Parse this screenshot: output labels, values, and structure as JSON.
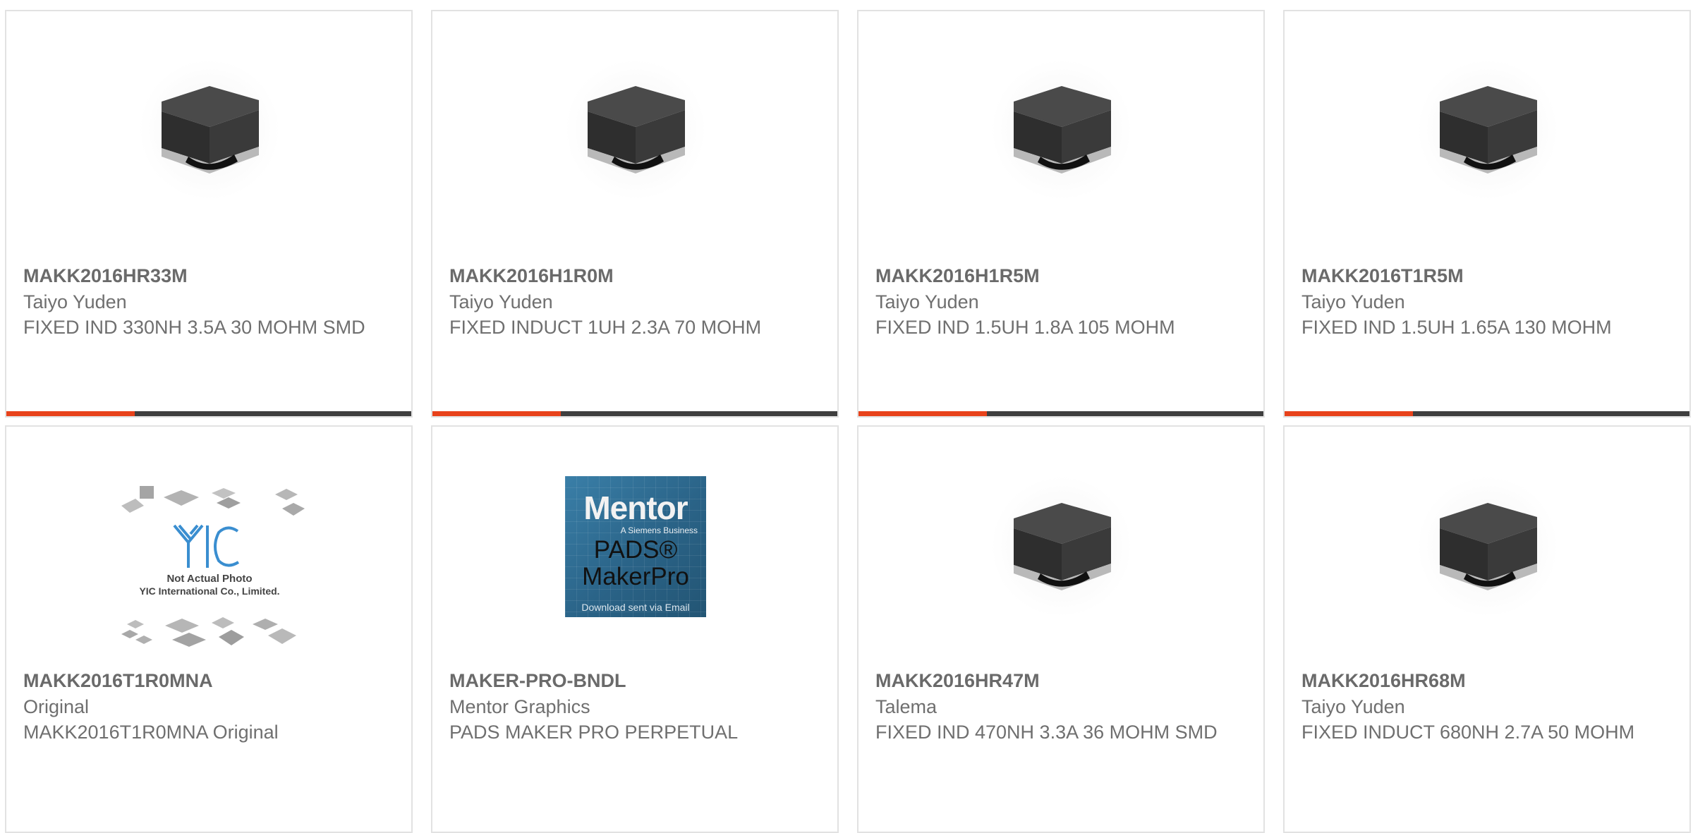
{
  "products": [
    {
      "part_number": "MAKK2016HR33M",
      "manufacturer": "Taiyo Yuden",
      "description": "FIXED IND 330NH 3.5A 30 MOHM SMD",
      "image": "inductor"
    },
    {
      "part_number": "MAKK2016H1R0M",
      "manufacturer": "Taiyo Yuden",
      "description": "FIXED INDUCT 1UH 2.3A 70 MOHM",
      "image": "inductor"
    },
    {
      "part_number": "MAKK2016H1R5M",
      "manufacturer": "Taiyo Yuden",
      "description": "FIXED IND 1.5UH 1.8A 105 MOHM",
      "image": "inductor"
    },
    {
      "part_number": "MAKK2016T1R5M",
      "manufacturer": "Taiyo Yuden",
      "description": "FIXED IND 1.5UH 1.65A 130 MOHM",
      "image": "inductor"
    },
    {
      "part_number": "MAKK2016T1R0MNA",
      "manufacturer": "Original",
      "description": "MAKK2016T1R0MNA Original",
      "image": "yic-placeholder",
      "image_text": {
        "line1": "Not Actual Photo",
        "line2": "YIC International Co., Limited."
      }
    },
    {
      "part_number": "MAKER-PRO-BNDL",
      "manufacturer": "Mentor Graphics",
      "description": "PADS MAKER PRO PERPETUAL",
      "image": "mentor-box",
      "image_text": {
        "brand": "Mentor",
        "tagline": "A Siemens Business",
        "product": "PADS® MakerPro",
        "footer": "Download sent via Email"
      }
    },
    {
      "part_number": "MAKK2016HR47M",
      "manufacturer": "Talema",
      "description": "FIXED IND 470NH 3.3A 36 MOHM SMD",
      "image": "inductor"
    },
    {
      "part_number": "MAKK2016HR68M",
      "manufacturer": "Taiyo Yuden",
      "description": "FIXED INDUCT 680NH 2.7A 50 MOHM",
      "image": "inductor"
    }
  ],
  "colors": {
    "accent": "#e8421b",
    "bar": "#3f3f3f",
    "border": "#e2e2e2",
    "text": "#6f6f6f"
  }
}
